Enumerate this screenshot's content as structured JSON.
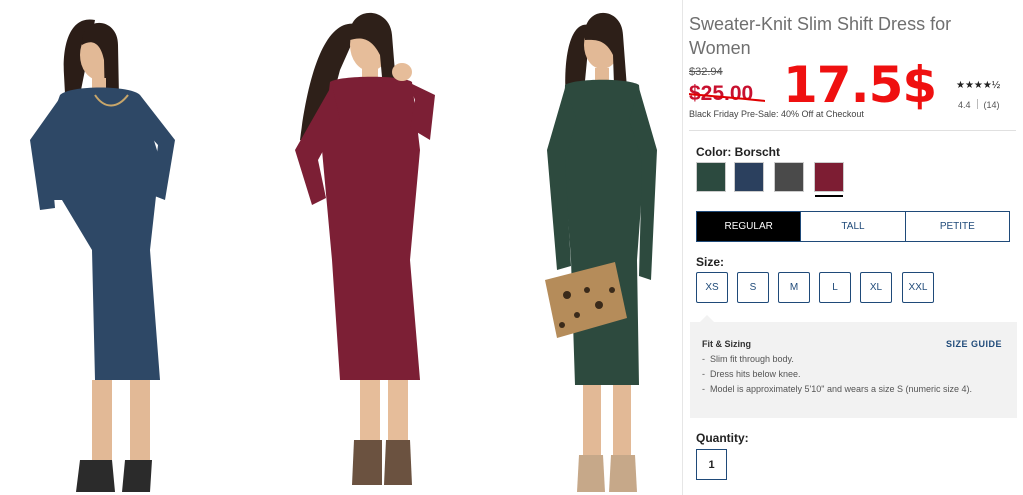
{
  "product": {
    "title": "Sweater-Knit Slim Shift Dress for Women",
    "old_price": "$32.94",
    "sale_price": "$25.00",
    "overlay_price": "17.5$",
    "presale_note": "Black Friday Pre-Sale: 40% Off at Checkout",
    "stars": "★★★★½",
    "rating_value": "4.4",
    "review_count": "(14)"
  },
  "color": {
    "label": "Color:",
    "selected_name": "Borscht",
    "swatches": [
      {
        "name": "green",
        "hex": "#2c4a3f"
      },
      {
        "name": "navy",
        "hex": "#2b405e"
      },
      {
        "name": "charcoal",
        "hex": "#4a4a4a"
      },
      {
        "name": "borscht",
        "hex": "#7d1d33"
      }
    ]
  },
  "fit_tabs": [
    "REGULAR",
    "TALL",
    "PETITE"
  ],
  "size": {
    "label": "Size:",
    "options": [
      "XS",
      "S",
      "M",
      "L",
      "XL",
      "XXL"
    ]
  },
  "fit_sizing": {
    "heading": "Fit & Sizing",
    "size_guide": "SIZE GUIDE",
    "items": [
      "Slim fit through body.",
      "Dress hits below knee.",
      "Model is approximately 5'10\" and wears a size S (numeric size 4)."
    ]
  },
  "quantity": {
    "label": "Quantity:",
    "value": "1"
  },
  "photos": [
    {
      "name": "model-navy-dress",
      "dress": "#2e4866",
      "skin": "#e2b996",
      "hair": "#2b1d17"
    },
    {
      "name": "model-borscht-dress",
      "dress": "#7c1f35",
      "skin": "#e6bd9a",
      "hair": "#2e2019"
    },
    {
      "name": "model-green-dress",
      "dress": "#2d4a3e",
      "skin": "#e2b996",
      "hair": "#2d1f18"
    }
  ]
}
